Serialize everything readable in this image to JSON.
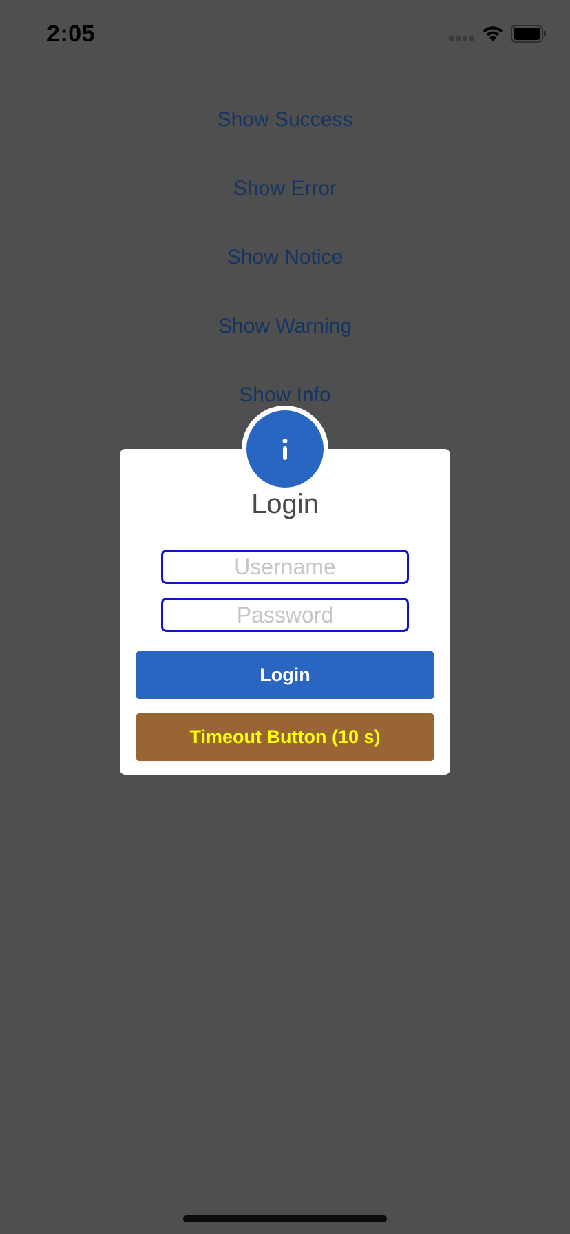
{
  "status_bar": {
    "time": "2:05"
  },
  "demo_buttons": [
    {
      "label": "Show Success"
    },
    {
      "label": "Show Error"
    },
    {
      "label": "Show Notice"
    },
    {
      "label": "Show Warning"
    },
    {
      "label": "Show Info"
    }
  ],
  "alert": {
    "icon": "info-icon",
    "title": "Login",
    "username_placeholder": "Username",
    "username_value": "",
    "password_placeholder": "Password",
    "password_value": "",
    "login_button_label": "Login",
    "timeout_button_label": "Timeout Button (10 s)"
  },
  "colors": {
    "overlay": "#4f4f4f",
    "accent": "#2866c1",
    "demo_button_text": "#153461",
    "field_border": "#1212d1",
    "timeout_bg": "#996633",
    "timeout_text": "#ffff00"
  }
}
